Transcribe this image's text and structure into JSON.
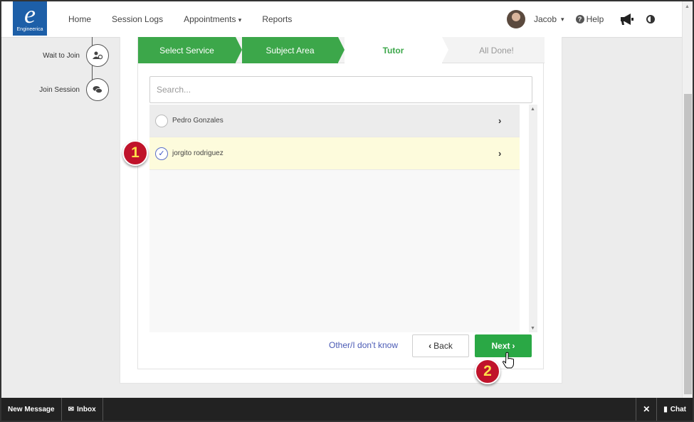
{
  "header": {
    "logo_letter": "e",
    "logo_text": "Engineerica",
    "nav": [
      {
        "label": "Home"
      },
      {
        "label": "Session Logs"
      },
      {
        "label": "Appointments"
      },
      {
        "label": "Reports"
      }
    ],
    "user_name": "Jacob",
    "help_label": "Help"
  },
  "sidebar_steps": [
    {
      "label": "Wait to Join"
    },
    {
      "label": "Join Session"
    }
  ],
  "wizard": {
    "steps": [
      {
        "label": "Select Service",
        "state": "done"
      },
      {
        "label": "Subject Area",
        "state": "done"
      },
      {
        "label": "Tutor",
        "state": "active"
      },
      {
        "label": "All Done!",
        "state": "pending"
      }
    ],
    "search_placeholder": "Search...",
    "tutors": [
      {
        "name": "Pedro Gonzales",
        "selected": false
      },
      {
        "name": "jorgito rodriguez",
        "selected": true
      }
    ],
    "other_link": "Other/I don't know",
    "back_label": "Back",
    "next_label": "Next"
  },
  "annotations": {
    "marker_1": "1",
    "marker_2": "2"
  },
  "bottom_bar": {
    "new_message": "New Message",
    "inbox": "Inbox",
    "chat": "Chat"
  },
  "colors": {
    "brand_blue": "#1d5fa8",
    "green": "#3ca74a",
    "selected_row": "#fdfbdc",
    "marker_red": "#c0132b"
  }
}
